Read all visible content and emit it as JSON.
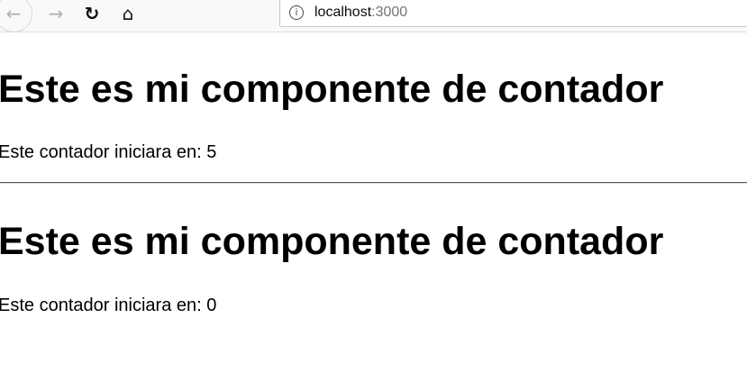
{
  "browser": {
    "url_host": "localhost",
    "url_port": ":3000",
    "icons": [
      "back-icon",
      "forward-icon",
      "reload-icon",
      "home-icon",
      "info-icon"
    ]
  },
  "components": [
    {
      "title": "Este es mi componente de contador",
      "text": "Este contador iniciara en: 5"
    },
    {
      "title": "Este es mi componente de contador",
      "text": "Este contador iniciara en: 0"
    }
  ]
}
